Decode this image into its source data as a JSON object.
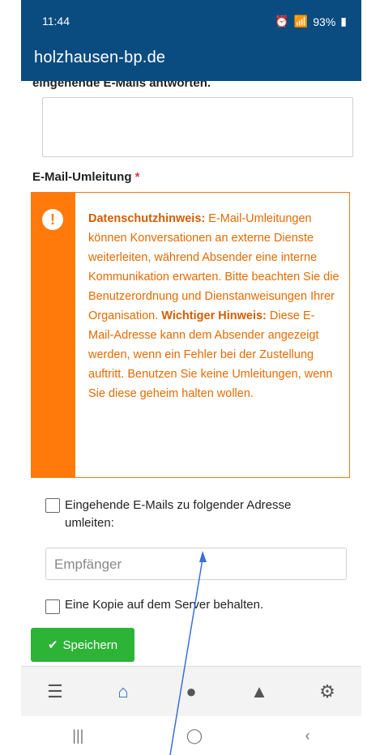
{
  "status": {
    "time": "11:44",
    "battery": "93%"
  },
  "app": {
    "title": "holzhausen-bp.de"
  },
  "form": {
    "cut_label": "eingehende E-Mails antworten.",
    "forward_label": "E-Mail-Umleitung",
    "required_mark": "*",
    "warning": {
      "privacy_title": "Datenschutzhinweis:",
      "privacy_text": "E-Mail-Umleitungen können Konversationen an externe Dienste weiterleiten, während Absender eine interne Kommunikation erwarten. Bitte beachten Sie die Benutzerordnung und Dienstanweisungen Ihrer Organisation.",
      "important_title": "Wichtiger Hinweis:",
      "important_text": "Diese E-Mail-Adresse kann dem Absender angezeigt werden, wenn ein Fehler bei der Zustellung auftritt. Benutzen Sie keine Umleitungen, wenn Sie diese geheim halten wollen."
    },
    "forward_checkbox_label": "Eingehende E-Mails zu folgender Adresse umleiten:",
    "recipient_placeholder": "Empfänger",
    "keep_copy_label": "Eine Kopie auf dem Server behalten.",
    "save_label": "Speichern"
  },
  "tabbar": {
    "items": [
      "menu-icon",
      "home-icon",
      "chat-icon",
      "bell-icon",
      "gear-icon"
    ],
    "active": "home-icon"
  },
  "sysnav": {
    "items": [
      "recent-apps-icon",
      "home-button-icon",
      "back-icon"
    ]
  },
  "colors": {
    "brand": "#0a4c80",
    "warning": "#ff7a0a",
    "save": "#2db336",
    "active_tab": "#1e6fbf"
  }
}
